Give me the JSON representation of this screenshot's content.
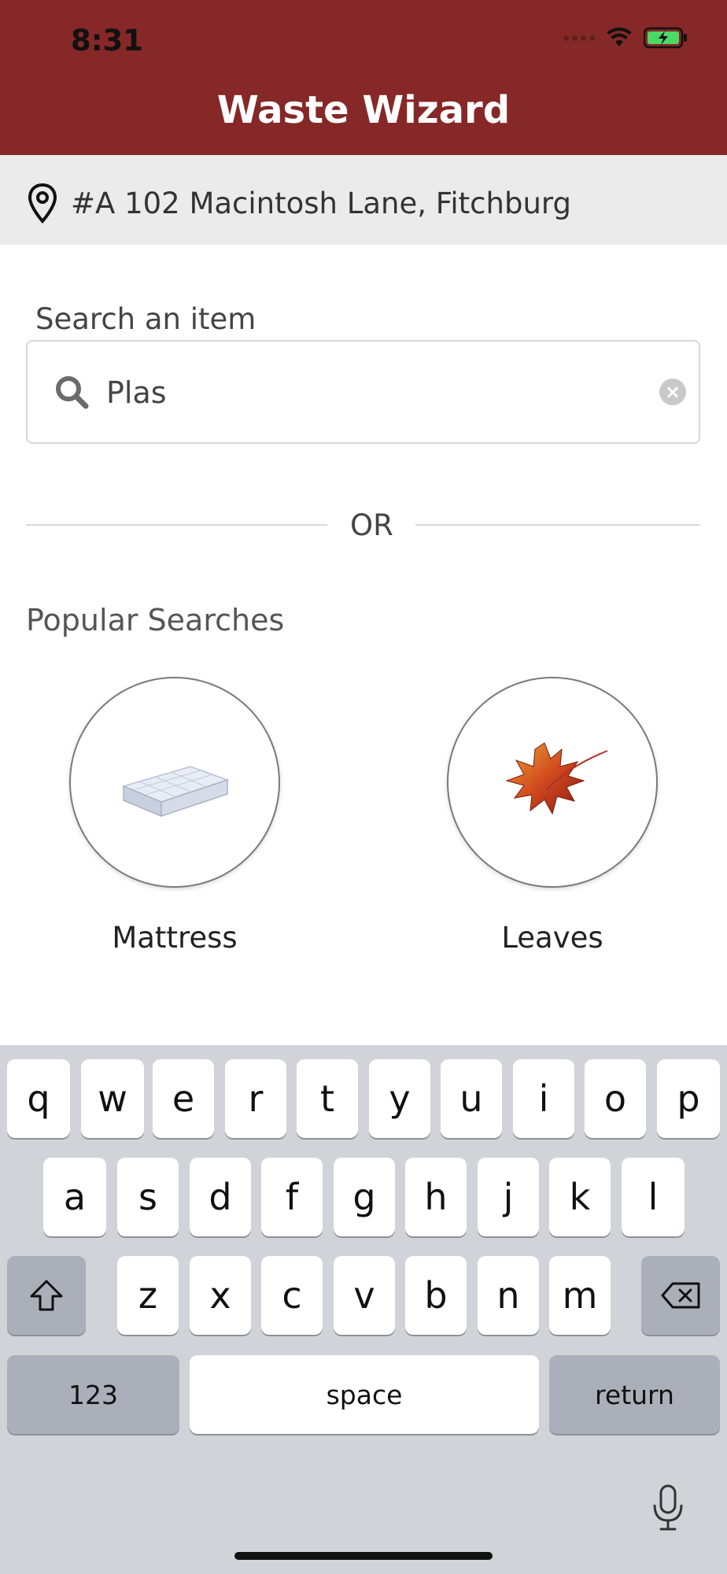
{
  "status_bar": {
    "time": "8:31"
  },
  "header": {
    "title": "Waste Wizard"
  },
  "location": {
    "address": "#A 102 Macintosh Lane, Fitchburg"
  },
  "search": {
    "label": "Search an item",
    "value": "Plas"
  },
  "divider": {
    "text": "OR"
  },
  "popular": {
    "title": "Popular Searches",
    "items": [
      {
        "label": "Mattress",
        "icon": "mattress-icon"
      },
      {
        "label": "Leaves",
        "icon": "leaf-icon"
      }
    ]
  },
  "keyboard": {
    "row1": [
      "q",
      "w",
      "e",
      "r",
      "t",
      "y",
      "u",
      "i",
      "o",
      "p"
    ],
    "row2": [
      "a",
      "s",
      "d",
      "f",
      "g",
      "h",
      "j",
      "k",
      "l"
    ],
    "row3": [
      "z",
      "x",
      "c",
      "v",
      "b",
      "n",
      "m"
    ],
    "numbers_label": "123",
    "space_label": "space",
    "return_label": "return"
  },
  "colors": {
    "header": "#852827",
    "location_bar": "#ebebeb",
    "keyboard_bg": "#d1d3d9"
  }
}
